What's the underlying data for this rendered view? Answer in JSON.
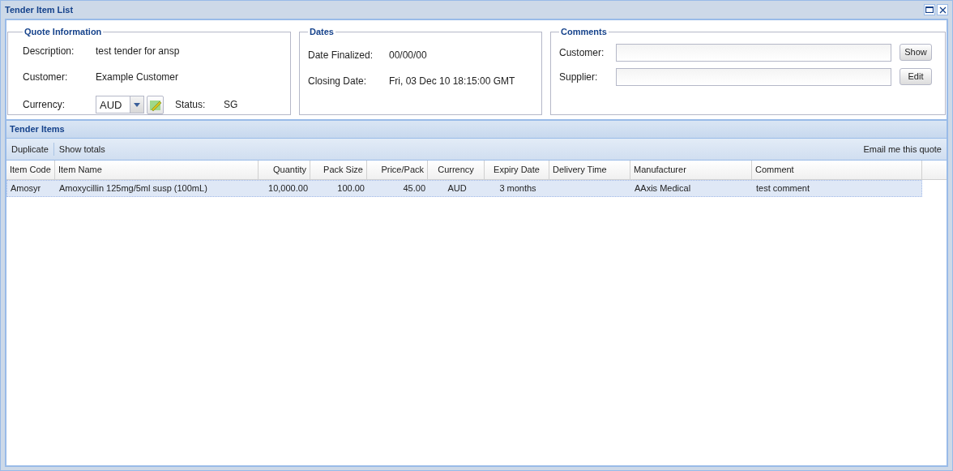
{
  "window": {
    "title": "Tender Item List"
  },
  "quote_information": {
    "title": "Quote Information",
    "description_label": "Description:",
    "description": "test tender for ansp",
    "customer_label": "Customer:",
    "customer": "Example Customer",
    "currency_label": "Currency:",
    "currency": "AUD",
    "status_label": "Status:",
    "status": "SG"
  },
  "dates": {
    "title": "Dates",
    "date_finalized_label": "Date Finalized:",
    "date_finalized": "00/00/00",
    "closing_date_label": "Closing Date:",
    "closing_date": "Fri, 03 Dec 10 18:15:00 GMT"
  },
  "comments": {
    "title": "Comments",
    "customer_label": "Customer:",
    "customer_button": "Show",
    "supplier_label": "Supplier:",
    "supplier_button": "Edit"
  },
  "tender_items": {
    "title": "Tender Items",
    "toolbar": [
      "Duplicate",
      "Show totals"
    ],
    "email_button": "Email me this quote",
    "columns": [
      {
        "label": "Item Code"
      },
      {
        "label": "Item Name"
      },
      {
        "label": "Quantity"
      },
      {
        "label": "Pack Size"
      },
      {
        "label": "Price/Pack"
      },
      {
        "label": "Currency"
      },
      {
        "label": "Expiry Date"
      },
      {
        "label": "Delivery Time"
      },
      {
        "label": "Manufacturer"
      },
      {
        "label": "Comment"
      }
    ],
    "rows": [
      {
        "selected": true,
        "cells": [
          "Amosyr",
          "Amoxycillin 125mg/5ml susp (100mL)",
          "10,000.00",
          "100.00",
          "45.00",
          "AUD",
          "3 months",
          "",
          "AAxis Medical",
          "test comment"
        ]
      }
    ]
  }
}
